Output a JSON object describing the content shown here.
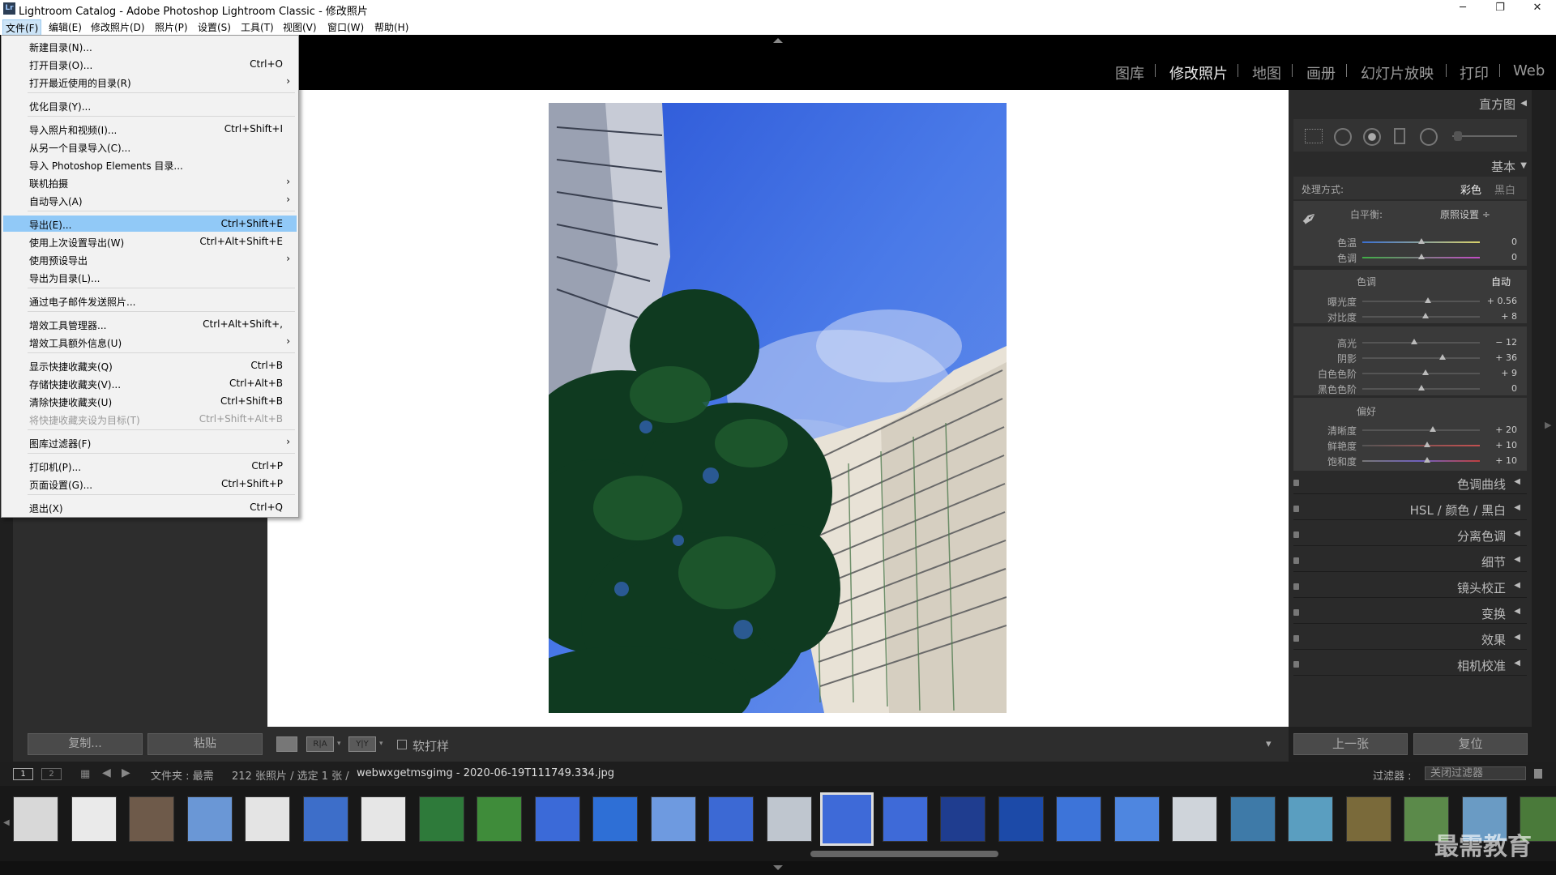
{
  "window": {
    "title": "Lightroom Catalog - Adobe Photoshop Lightroom Classic - 修改照片",
    "logo": "Lr",
    "minimize": "─",
    "maximize": "❐",
    "close": "✕"
  },
  "menubar": [
    "文件(F)",
    "编辑(E)",
    "修改照片(D)",
    "照片(P)",
    "设置(S)",
    "工具(T)",
    "视图(V)",
    "窗口(W)",
    "帮助(H)"
  ],
  "modules": [
    "图库",
    "修改照片",
    "地图",
    "画册",
    "幻灯片放映",
    "打印",
    "Web"
  ],
  "file_menu": [
    {
      "label": "新建目录(N)...",
      "shortcut": ""
    },
    {
      "label": "打开目录(O)...",
      "shortcut": "Ctrl+O"
    },
    {
      "label": "打开最近使用的目录(R)",
      "shortcut": "",
      "submenu": true
    },
    {
      "label": "优化目录(Y)...",
      "shortcut": ""
    },
    {
      "label": "导入照片和视频(I)...",
      "shortcut": "Ctrl+Shift+I"
    },
    {
      "label": "从另一个目录导入(C)...",
      "shortcut": ""
    },
    {
      "label": "导入 Photoshop Elements 目录...",
      "shortcut": ""
    },
    {
      "label": "联机拍摄",
      "shortcut": "",
      "submenu": true
    },
    {
      "label": "自动导入(A)",
      "shortcut": "",
      "submenu": true
    },
    {
      "label": "导出(E)...",
      "shortcut": "Ctrl+Shift+E",
      "highlighted": true
    },
    {
      "label": "使用上次设置导出(W)",
      "shortcut": "Ctrl+Alt+Shift+E"
    },
    {
      "label": "使用预设导出",
      "shortcut": "",
      "submenu": true
    },
    {
      "label": "导出为目录(L)...",
      "shortcut": ""
    },
    {
      "label": "通过电子邮件发送照片...",
      "shortcut": ""
    },
    {
      "label": "增效工具管理器...",
      "shortcut": "Ctrl+Alt+Shift+,"
    },
    {
      "label": "增效工具额外信息(U)",
      "shortcut": "",
      "submenu": true
    },
    {
      "label": "显示快捷收藏夹(Q)",
      "shortcut": "Ctrl+B"
    },
    {
      "label": "存储快捷收藏夹(V)...",
      "shortcut": "Ctrl+Alt+B"
    },
    {
      "label": "清除快捷收藏夹(U)",
      "shortcut": "Ctrl+Shift+B"
    },
    {
      "label": "将快捷收藏夹设为目标(T)",
      "shortcut": "Ctrl+Shift+Alt+B",
      "disabled": true
    },
    {
      "label": "图库过滤器(F)",
      "shortcut": "",
      "submenu": true
    },
    {
      "label": "打印机(P)...",
      "shortcut": "Ctrl+P"
    },
    {
      "label": "页面设置(G)...",
      "shortcut": "Ctrl+Shift+P"
    },
    {
      "label": "退出(X)",
      "shortcut": "Ctrl+Q"
    }
  ],
  "left_buttons": {
    "copy": "复制...",
    "paste": "粘贴"
  },
  "toolbar": {
    "view1": "",
    "ra": "R|A",
    "yy": "Y|Y",
    "softproof": "软打样",
    "dropdown": "▾"
  },
  "right_panel": {
    "histogram": "直方图",
    "basic": "基本",
    "treatment_label": "处理方式:",
    "treatment_color": "彩色",
    "treatment_bw": "黑白",
    "wb_label": "白平衡:",
    "wb_value": "原照设置 ÷",
    "tone_label": "色调",
    "tone_auto": "自动",
    "presence_label": "偏好",
    "sliders": [
      {
        "label": "色温",
        "value": "0",
        "pos": 0.5
      },
      {
        "label": "色调",
        "value": "0",
        "pos": 0.5
      },
      {
        "label": "曝光度",
        "value": "+ 0.56",
        "pos": 0.56
      },
      {
        "label": "对比度",
        "value": "+ 8",
        "pos": 0.54
      },
      {
        "label": "高光",
        "value": "− 12",
        "pos": 0.44
      },
      {
        "label": "阴影",
        "value": "+ 36",
        "pos": 0.68
      },
      {
        "label": "白色色阶",
        "value": "+ 9",
        "pos": 0.54
      },
      {
        "label": "黑色色阶",
        "value": "0",
        "pos": 0.5
      },
      {
        "label": "清晰度",
        "value": "+ 20",
        "pos": 0.6
      },
      {
        "label": "鲜艳度",
        "value": "+ 10",
        "pos": 0.55
      },
      {
        "label": "饱和度",
        "value": "+ 10",
        "pos": 0.55
      }
    ],
    "collapsed": [
      "色调曲线",
      "HSL / 颜色 / 黑白",
      "分离色调",
      "细节",
      "镜头校正",
      "变换",
      "效果",
      "相机校准"
    ],
    "prev": "上一张",
    "reset": "复位"
  },
  "filmbar": {
    "view1": "1",
    "view2": "2",
    "source": "文件夹 : 最需",
    "count": "212 张照片 / 选定 1 张 /",
    "filename": "webwxgetmsgimg - 2020-06-19T111749.334.jpg",
    "filter_label": "过滤器 :",
    "filter_value": "关闭过滤器"
  },
  "watermark": "最需教育",
  "colors": {
    "accent": "#91c9f7",
    "panel": "#2d2d2d",
    "sky": "#3d6fe0"
  }
}
